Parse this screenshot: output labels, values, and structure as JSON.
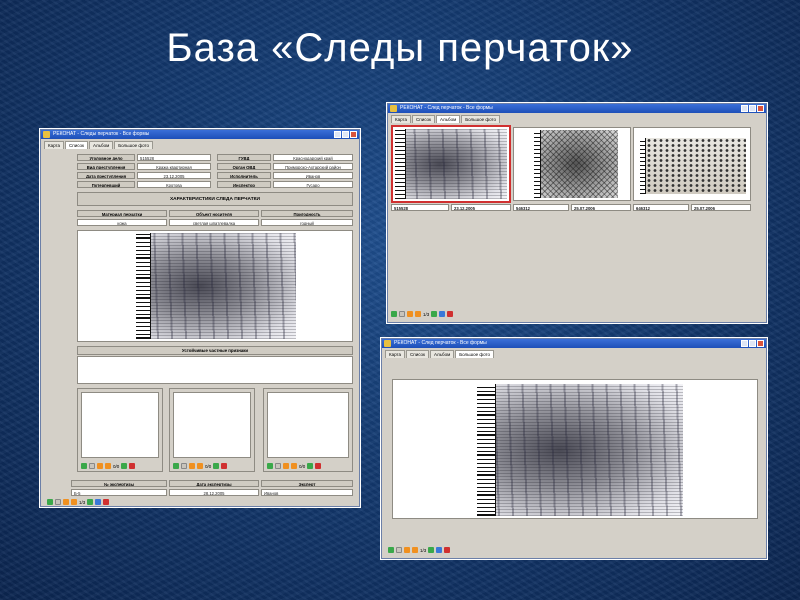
{
  "slide": {
    "title": "База «Следы перчаток»"
  },
  "window_form": {
    "title": "РЕКОНАТ - Следы перчаток - Все формы",
    "tabs": [
      "Карта",
      "Список",
      "Альбом",
      "Большое фото"
    ],
    "fields": [
      {
        "label": "Уголовное дело",
        "value": "515528"
      },
      {
        "label": "Вид преступления",
        "value": "Кража квартирная"
      },
      {
        "label": "Дата преступления",
        "value": "23.12.2005"
      },
      {
        "label": "Потерпевший",
        "value": "Кротова"
      }
    ],
    "fields_right": [
      {
        "label": "ГУВД",
        "value": "Краснодарский край"
      },
      {
        "label": "Орган ОВД",
        "value": "Приморско-Ахтарский район"
      },
      {
        "label": "Исполнитель",
        "value": "Иванов"
      },
      {
        "label": "Инспектор",
        "value": "Гусаро"
      }
    ],
    "section_characteristics": "ХАРАКТЕРИСТИКИ СЛЕДА ПЕРЧАТКИ",
    "columns": [
      {
        "label": "Материал перчатки",
        "value": "кожа"
      },
      {
        "label": "Объект носителя",
        "value": "светлая шпатлевалка"
      },
      {
        "label": "Пригодность",
        "value": "годный"
      }
    ],
    "section_features": "Устойчивые частные признаки",
    "page_counter": "0/0",
    "bottom_fields": [
      {
        "label": "№ экспертизы",
        "value": "Б-5"
      },
      {
        "label": "Дата экспертизы",
        "value": "28.12.2005"
      },
      {
        "label": "Эксперт",
        "value": "Иванов"
      }
    ],
    "main_counter": "1/3"
  },
  "window_list": {
    "title": "РЕКОНАТ - След перчаток - Все формы",
    "tabs": [
      "Карта",
      "Список",
      "Альбом",
      "Большое фото"
    ],
    "items": [
      {
        "id": "515528",
        "date": "23.12.2005"
      },
      {
        "id": "546312",
        "date": "25.07.2006"
      },
      {
        "id": "646312",
        "date": "25.07.2006"
      }
    ],
    "counter": "1/3"
  },
  "window_photo": {
    "title": "РЕКОНАТ - След перчаток - Все формы",
    "tabs": [
      "Карта",
      "Список",
      "Альбом",
      "Большое фото"
    ],
    "counter": "1/3"
  },
  "colors": {
    "accent_green": "#3aa84a",
    "accent_orange": "#f09020",
    "accent_blue": "#3a78d8",
    "accent_red": "#d03030"
  },
  "icons": [
    "first-record-icon",
    "edit-icon",
    "save-icon",
    "prev-icon",
    "next-icon",
    "delete-icon"
  ]
}
